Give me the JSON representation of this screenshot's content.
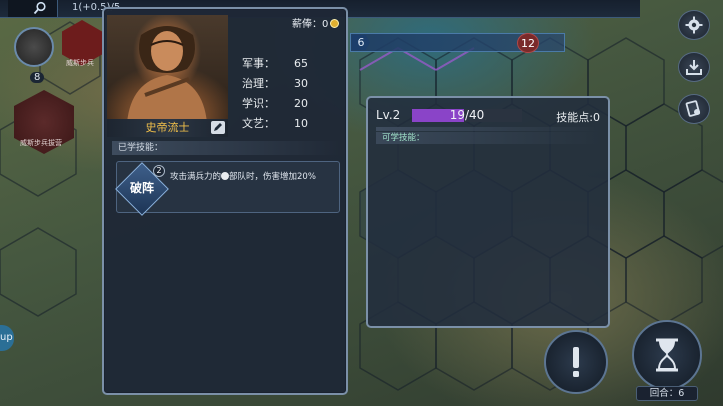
{
  "topbar": {
    "resources": "1(+0.5)/5"
  },
  "map": {
    "turn_start": "6",
    "turn_end": "12",
    "unit1_label": "威斯步兵",
    "unit2_label": "威斯步兵拔营",
    "unit_count": "8"
  },
  "left_tab": {
    "label": "up"
  },
  "general": {
    "name": "史帝流士",
    "salary_label": "薪俸：",
    "salary_value": "0",
    "stats": [
      {
        "label": "军事：",
        "value": "65"
      },
      {
        "label": "治理：",
        "value": "30"
      },
      {
        "label": "学识：",
        "value": "20"
      },
      {
        "label": "文艺：",
        "value": "10"
      }
    ],
    "learned_skills_label": "已学技能：",
    "skill": {
      "name": "破阵",
      "level": "2",
      "desc_part1": "攻击满兵力的",
      "desc_part2": "部队时，伤害增加20%"
    }
  },
  "level_panel": {
    "level": "Lv.2",
    "xp_text": "19/40",
    "xp_current": 19,
    "xp_max": 40,
    "skill_points": "技能点:0",
    "learnable_label": "可学技能："
  },
  "round": {
    "label": "回合：",
    "value": "6"
  },
  "colors": {
    "accent_gold": "#f2c04a",
    "xp_purple": "#8a44c8",
    "panel_border": "#7b90a8"
  }
}
